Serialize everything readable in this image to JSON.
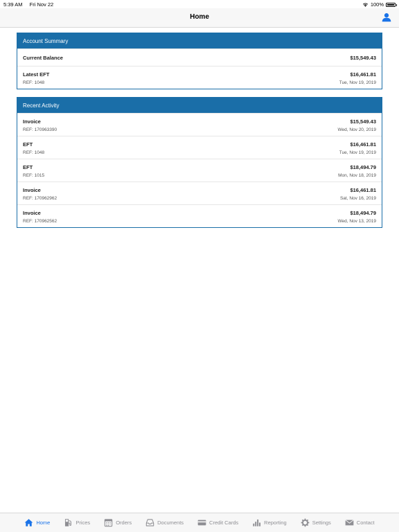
{
  "status": {
    "time": "5:39 AM",
    "date": "Fri Nov 22",
    "battery": "100%"
  },
  "nav": {
    "title": "Home",
    "user_icon": "user-icon"
  },
  "account_summary": {
    "title": "Account Summary",
    "current_balance": {
      "label": "Current Balance",
      "amount": "$15,549.43"
    },
    "latest_eft": {
      "label": "Latest EFT",
      "amount": "$16,461.81",
      "ref": "REF: 1048",
      "date": "Tue, Nov 19, 2019"
    }
  },
  "recent_activity": {
    "title": "Recent Activity",
    "items": [
      {
        "label": "Invoice",
        "amount": "$15,549.43",
        "ref": "REF: 170963390",
        "date": "Wed, Nov 20, 2019"
      },
      {
        "label": "EFT",
        "amount": "$16,461.81",
        "ref": "REF: 1048",
        "date": "Tue, Nov 19, 2019"
      },
      {
        "label": "EFT",
        "amount": "$18,494.79",
        "ref": "REF: 1015",
        "date": "Mon, Nov 18, 2019"
      },
      {
        "label": "Invoice",
        "amount": "$16,461.81",
        "ref": "REF: 170962962",
        "date": "Sat, Nov 16, 2019"
      },
      {
        "label": "Invoice",
        "amount": "$18,494.79",
        "ref": "REF: 170962562",
        "date": "Wed, Nov 13, 2019"
      }
    ]
  },
  "tabs": [
    {
      "label": "Home",
      "icon": "home-icon",
      "active": true
    },
    {
      "label": "Prices",
      "icon": "fuel-pump-icon"
    },
    {
      "label": "Orders",
      "icon": "calendar-icon"
    },
    {
      "label": "Documents",
      "icon": "inbox-icon"
    },
    {
      "label": "Credit Cards",
      "icon": "credit-card-icon"
    },
    {
      "label": "Reporting",
      "icon": "bar-chart-icon"
    },
    {
      "label": "Settings",
      "icon": "gear-icon"
    },
    {
      "label": "Contact",
      "icon": "envelope-icon"
    }
  ],
  "colors": {
    "accent": "#1a6ea8",
    "tab_active": "#1a73e8",
    "tab_inactive": "#8e8e93"
  }
}
